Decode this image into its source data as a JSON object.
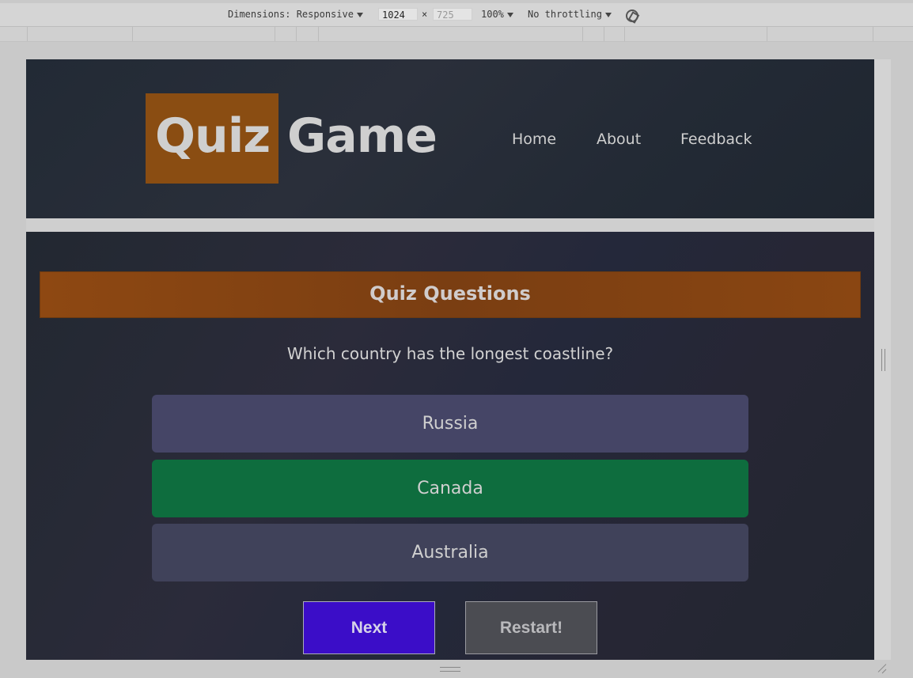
{
  "devtools": {
    "dimensions_label": "Dimensions: Responsive",
    "width_value": "1024",
    "height_placeholder": "725",
    "times": "×",
    "zoom": "100%",
    "throttling": "No throttling",
    "rotate_icon": "rotate-icon"
  },
  "header": {
    "logo_part1": "Quiz",
    "logo_part2": "Game",
    "nav": [
      "Home",
      "About",
      "Feedback"
    ]
  },
  "main": {
    "title": "Quiz Questions",
    "question": "Which country has the longest coastline?",
    "answers": [
      "Russia",
      "Canada",
      "Australia"
    ],
    "next_label": "Next",
    "restart_label": "Restart!"
  },
  "colors": {
    "logo_box": "#8a4d12",
    "title_bar": "#8e4812",
    "answer_default": "#454566",
    "answer_correct": "#0e6d3e",
    "next_button": "#3b0dc8",
    "restart_button": "#4b4c52"
  }
}
